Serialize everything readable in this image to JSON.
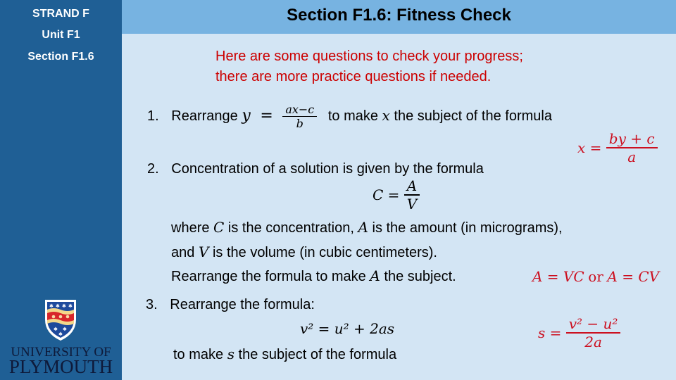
{
  "sidebar": {
    "strand": "STRAND F",
    "unit": "Unit F1",
    "section": "Section F1.6",
    "logo": {
      "line1": "UNIVERSITY OF",
      "line2": "PLYMOUTH",
      "icon": "university-crest-icon"
    }
  },
  "header": {
    "title": "Section F1.6: Fitness Check"
  },
  "intro": {
    "line1": "Here are some questions to check your progress;",
    "line2": "there are more practice questions if needed."
  },
  "questions": [
    {
      "number": "1.",
      "prefix": "Rearrange",
      "lhs": "y",
      "eq": "=",
      "num": "ax−c",
      "den": "b",
      "suffix_a": "to make",
      "var": "x",
      "suffix_b": "the subject of the formula",
      "answer": {
        "lhs": "x =",
        "num": "by + c",
        "den": "a"
      }
    },
    {
      "number": "2.",
      "text": "Concentration of a solution is given by the formula",
      "formula": {
        "lhs": "C =",
        "num": "A",
        "den": "V"
      },
      "line1": {
        "a": "where",
        "v1": "C",
        "b": "is the concentration,",
        "v2": "A",
        "c": "is the amount (in micrograms),"
      },
      "line2": {
        "a": "and",
        "v1": "V",
        "b": "is the volume (in cubic centimeters)."
      },
      "line3": {
        "a": "Rearrange the formula to make",
        "v1": "A",
        "b": "the subject."
      },
      "answer": {
        "p1": "A = VC",
        "or": "or",
        "p2": "A = CV"
      }
    },
    {
      "number": "3.",
      "text": "Rearrange the formula:",
      "formula": "v² = u² + 2as",
      "line": {
        "a": "to make",
        "v1": "s",
        "b": "the subject of the formula"
      },
      "answer": {
        "lhs": "s =",
        "num": "v² − u²",
        "den": "2a"
      }
    }
  ],
  "colors": {
    "sidebar": "#1f5f95",
    "header": "#77b3e1",
    "background": "#d3e5f4",
    "accent_red": "#cc0000"
  }
}
